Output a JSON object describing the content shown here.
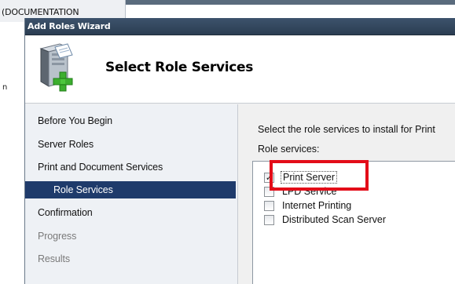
{
  "background": {
    "partial_title": "(DOCUMENTATION",
    "stray_char": "n"
  },
  "wizard": {
    "title": "Add Roles Wizard",
    "header": {
      "title": "Select Role Services",
      "icon": "server-add-icon"
    },
    "nav": [
      {
        "label": "Before You Begin",
        "state": "normal"
      },
      {
        "label": "Server Roles",
        "state": "normal"
      },
      {
        "label": "Print and Document Services",
        "state": "normal"
      },
      {
        "label": "Role Services",
        "state": "selected"
      },
      {
        "label": "Confirmation",
        "state": "normal"
      },
      {
        "label": "Progress",
        "state": "disabled"
      },
      {
        "label": "Results",
        "state": "disabled"
      }
    ],
    "content": {
      "description": "Select the role services to install for Print",
      "role_services_label": "Role services:",
      "services": [
        {
          "label": "Print Server",
          "checked": true
        },
        {
          "label": "LPD Service",
          "checked": false
        },
        {
          "label": "Internet Printing",
          "checked": false
        },
        {
          "label": "Distributed Scan Server",
          "checked": false
        }
      ]
    }
  },
  "colors": {
    "nav_selected_bg": "#1f3b6b",
    "highlight_border": "#e30c18",
    "titlebar": "#2f435a"
  }
}
